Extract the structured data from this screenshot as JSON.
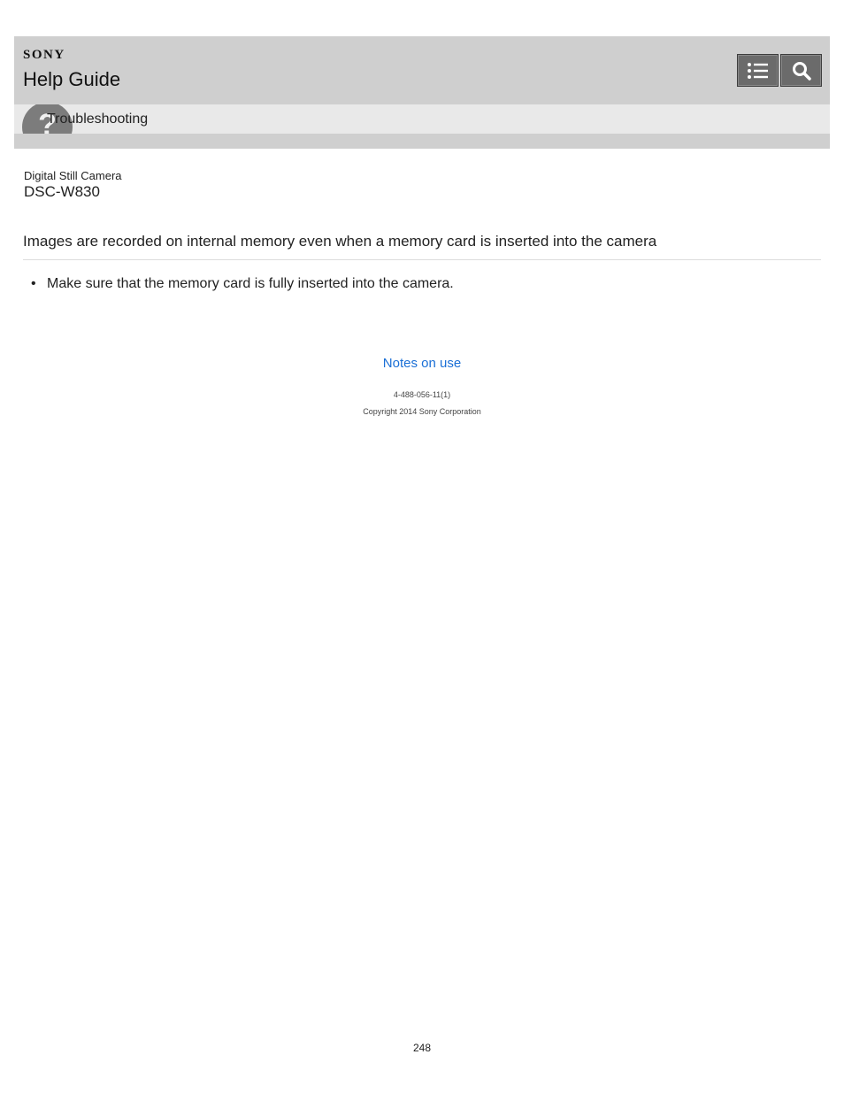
{
  "header": {
    "brand": "SONY",
    "title": "Help Guide",
    "buttons": [
      {
        "icon": "list-icon"
      },
      {
        "icon": "search-icon"
      }
    ]
  },
  "category": {
    "icon_glyph": "?",
    "label": "Troubleshooting"
  },
  "product": {
    "type": "Digital Still Camera",
    "model": "DSC-W830"
  },
  "topic": {
    "title": "Images are recorded on internal memory even when a memory card is inserted into the camera",
    "items": [
      "Make sure that the memory card is fully inserted into the camera."
    ]
  },
  "footer": {
    "link": "Notes on use",
    "doc_number": "4-488-056-11(1)",
    "copyright": "Copyright 2014 Sony Corporation",
    "page_number": "248"
  },
  "colors": {
    "header_bg": "#cfcfcf",
    "category_bg": "#e9e9e9",
    "link": "#1a6fd6",
    "button_bg": "#6b6b6b"
  }
}
